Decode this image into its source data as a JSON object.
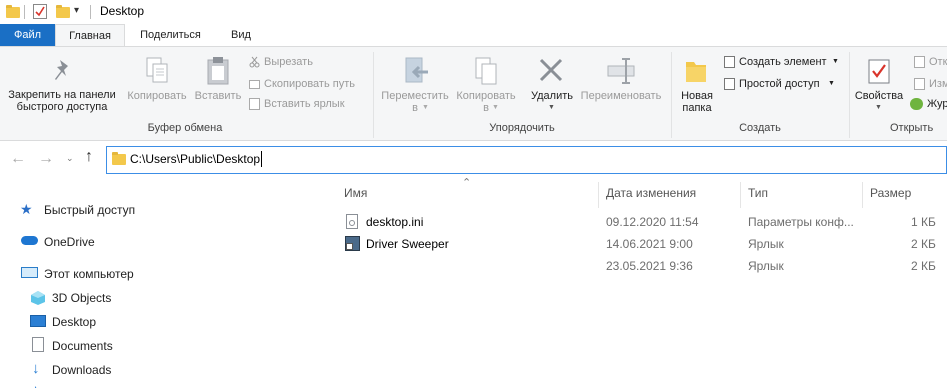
{
  "window": {
    "title": "Desktop"
  },
  "tabs": {
    "file": "Файл",
    "home": "Главная",
    "share": "Поделиться",
    "view": "Вид"
  },
  "ribbon": {
    "clipboard": {
      "pin": "Закрепить на панели быстрого доступа",
      "pin_line1": "Закрепить на панели",
      "pin_line2": "быстрого доступа",
      "copy": "Копировать",
      "paste": "Вставить",
      "cut": "Вырезать",
      "copy_path": "Скопировать путь",
      "paste_shortcut": "Вставить ярлык",
      "label": "Буфер обмена"
    },
    "organize": {
      "move_line1": "Переместить",
      "move_line2": "в",
      "copy_line1": "Копировать",
      "copy_line2": "в",
      "delete": "Удалить",
      "rename": "Переименовать",
      "label": "Упорядочить"
    },
    "create": {
      "new_folder_line1": "Новая",
      "new_folder_line2": "папка",
      "new_item": "Создать элемент",
      "easy_access": "Простой доступ",
      "label": "Создать"
    },
    "open": {
      "properties": "Свойства",
      "open_partial": "Отк",
      "edit_partial": "Изм",
      "history_partial": "Жур",
      "label": "Открыть"
    }
  },
  "address": {
    "path": "C:\\Users\\Public\\Desktop"
  },
  "nav_pane": {
    "quick_access": "Быстрый доступ",
    "onedrive": "OneDrive",
    "this_pc": "Этот компьютер",
    "objects3d": "3D Objects",
    "desktop": "Desktop",
    "documents": "Documents",
    "downloads": "Downloads"
  },
  "columns": {
    "name": "Имя",
    "date": "Дата изменения",
    "type": "Тип",
    "size": "Размер"
  },
  "files": [
    {
      "name": "desktop.ini",
      "date": "09.12.2020 11:54",
      "type": "Параметры конф...",
      "size": "1 КБ"
    },
    {
      "name": "Driver Sweeper",
      "date": "14.06.2021 9:00",
      "type": "Ярлык",
      "size": "2 КБ"
    },
    {
      "name": "",
      "date": "23.05.2021 9:36",
      "type": "Ярлык",
      "size": "2 КБ"
    }
  ],
  "colors": {
    "accent": "#1a6fc5",
    "folder": "#f3c84b",
    "address_border": "#3c8ee6"
  }
}
